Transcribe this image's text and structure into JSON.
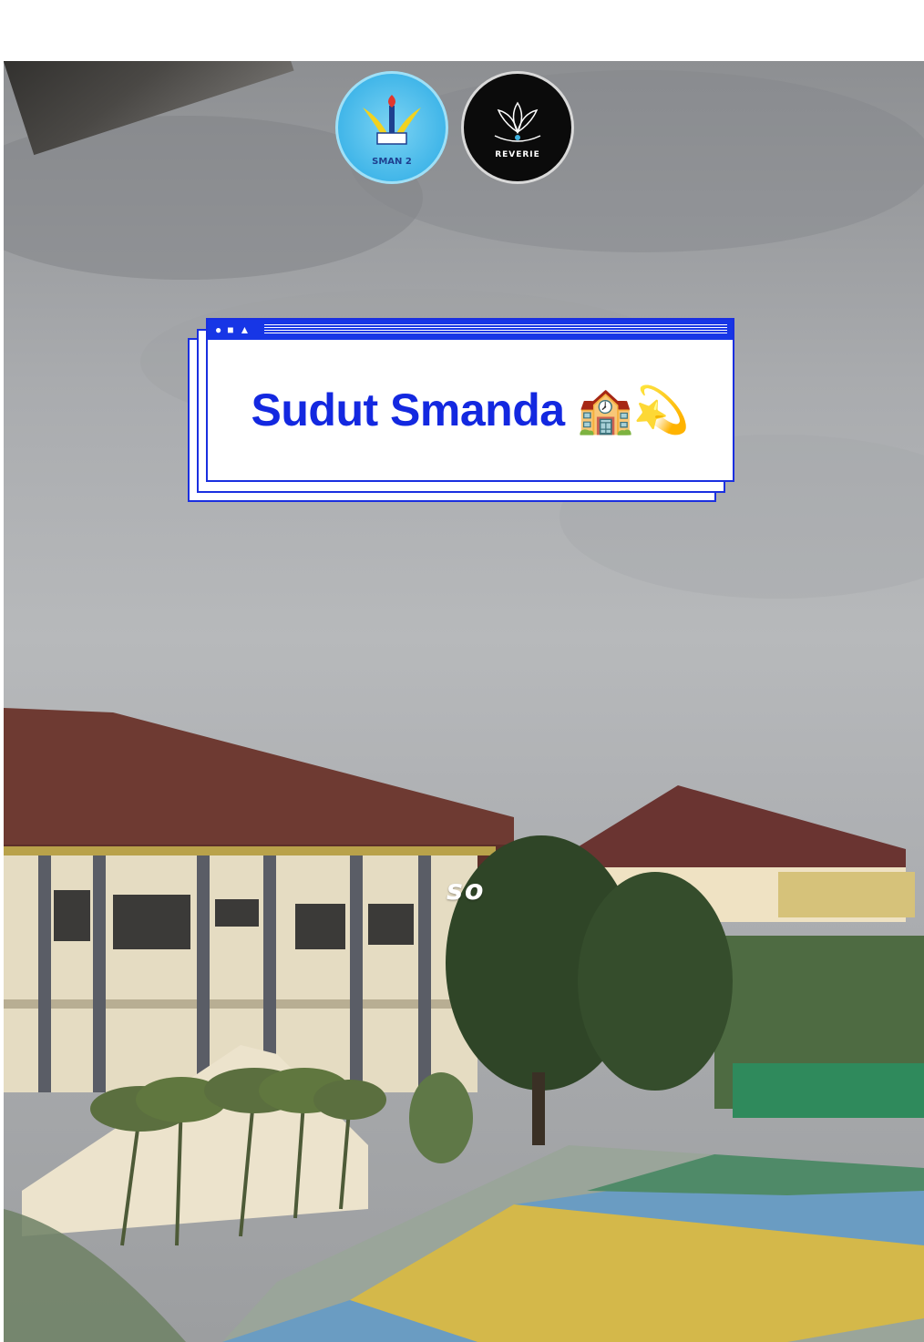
{
  "title": "Sudut Smanda 🏫💫",
  "overlay_word": "so",
  "logos": [
    {
      "name": "school-logo",
      "text": "SMAN 2",
      "icon": "school-emblem-icon"
    },
    {
      "name": "reverie-logo",
      "text": "REVERIE",
      "icon": "lotus-icon"
    }
  ],
  "colors": {
    "accent": "#1736e6",
    "title": "#1328e0"
  }
}
